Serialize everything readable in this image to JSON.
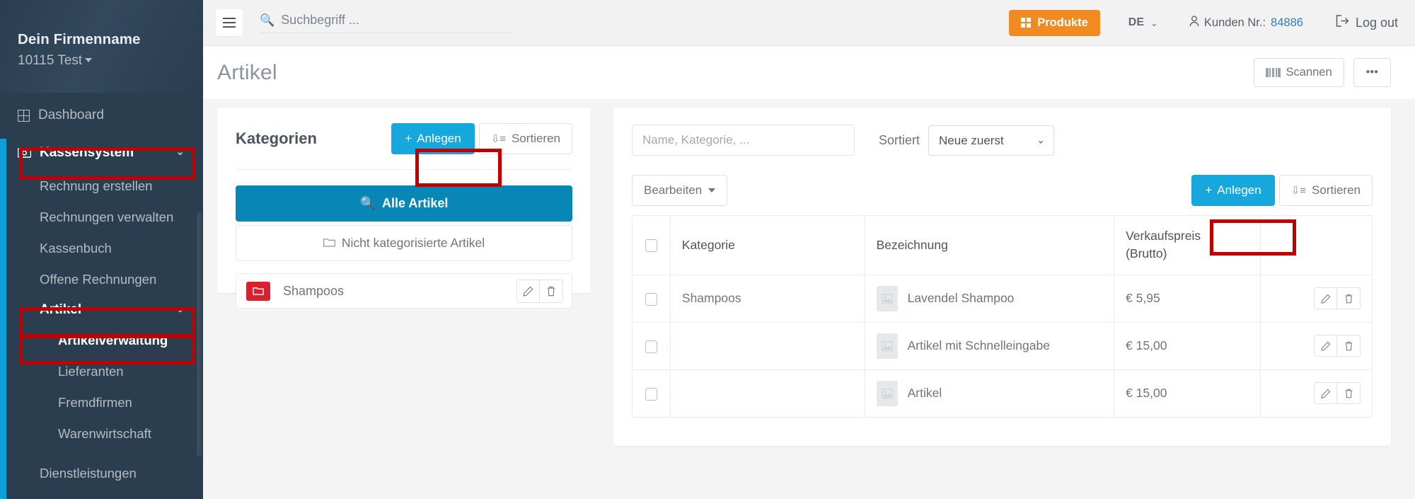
{
  "sidebar": {
    "brand": {
      "name": "Dein Firmenname",
      "sub": "10115 Test"
    },
    "items": [
      {
        "label": "Dashboard",
        "icon": "grid-icon",
        "type": "top"
      },
      {
        "label": "Kassensystem",
        "icon": "cash-icon",
        "type": "parent",
        "expanded": true,
        "highlighted": true
      },
      {
        "label": "Rechnung erstellen",
        "type": "sub"
      },
      {
        "label": "Rechnungen verwalten",
        "type": "sub"
      },
      {
        "label": "Kassenbuch",
        "type": "sub"
      },
      {
        "label": "Offene Rechnungen",
        "type": "sub"
      },
      {
        "label": "Artikel",
        "type": "parent-sub",
        "expanded": true,
        "highlighted": true
      },
      {
        "label": "Artikelverwaltung",
        "type": "sub",
        "current": true,
        "highlighted": true
      },
      {
        "label": "Lieferanten",
        "type": "sub"
      },
      {
        "label": "Fremdfirmen",
        "type": "sub"
      },
      {
        "label": "Warenwirtschaft",
        "type": "sub"
      },
      {
        "label": "Dienstleistungen",
        "type": "sub-group"
      }
    ]
  },
  "topbar": {
    "menu_icon": "hamburger-icon",
    "search": {
      "placeholder": "Suchbegriff ...",
      "value": "",
      "icon": "search-icon"
    },
    "produkte_label": "Produkte",
    "language": "DE",
    "customer_label": "Kunden Nr.:",
    "customer_number": "84886",
    "logout_label": "Log out"
  },
  "page": {
    "title": "Artikel",
    "scan_label": "Scannen",
    "more_label": "•••"
  },
  "categories": {
    "title": "Kategorien",
    "create_label": "Anlegen",
    "sort_label": "Sortieren",
    "all_articles_label": "Alle Artikel",
    "uncategorized_label": "Nicht kategorisierte Artikel",
    "rows": [
      {
        "name": "Shampoos",
        "color": "#d9202e",
        "edit_icon": "pencil-icon",
        "delete_icon": "trash-icon"
      }
    ]
  },
  "list": {
    "filter_placeholder": "Name, Kategorie, ...",
    "filter_value": "",
    "sorted_label": "Sortiert",
    "sort_value": "Neue zuerst",
    "sort_options": [
      "Neue zuerst"
    ],
    "edit_label": "Bearbeiten",
    "create_label": "Anlegen",
    "sort_button_label": "Sortieren",
    "columns": [
      "",
      "Kategorie",
      "Bezeichnung",
      "Verkaufspreis (Brutto)",
      ""
    ],
    "column_price_line1": "Verkaufspreis",
    "column_price_line2": "(Brutto)",
    "rows": [
      {
        "kategorie": "Shampoos",
        "bezeichnung": "Lavendel Shampoo",
        "preis": "€ 5,95"
      },
      {
        "kategorie": "",
        "bezeichnung": "Artikel mit Schnelleingabe",
        "preis": "€ 15,00"
      },
      {
        "kategorie": "",
        "bezeichnung": "Artikel",
        "preis": "€ 15,00"
      }
    ]
  },
  "colors": {
    "sidebar_bg": "#2b3e50",
    "accent_blue": "#16a7dc",
    "deep_blue": "#0886b5",
    "orange": "#f28a22",
    "red_highlight": "#c00000",
    "category_red": "#d9202e",
    "link_blue": "#2a7fba"
  }
}
